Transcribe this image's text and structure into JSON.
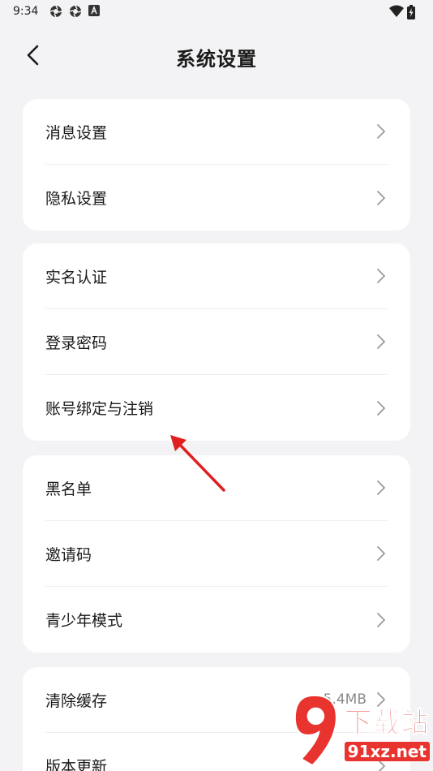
{
  "status_bar": {
    "time": "9:34",
    "icons_left": [
      "aperture-icon",
      "aperture-icon",
      "accessibility-a-icon"
    ],
    "icons_right": [
      "wifi-icon",
      "battery-charging-icon"
    ]
  },
  "header": {
    "back_icon": "chevron-left-icon",
    "title": "系统设置"
  },
  "groups": [
    {
      "items": [
        {
          "label": "消息设置"
        },
        {
          "label": "隐私设置"
        }
      ]
    },
    {
      "items": [
        {
          "label": "实名认证"
        },
        {
          "label": "登录密码"
        },
        {
          "label": "账号绑定与注销"
        }
      ]
    },
    {
      "items": [
        {
          "label": "黑名单"
        },
        {
          "label": "邀请码"
        },
        {
          "label": "青少年模式"
        }
      ]
    },
    {
      "items": [
        {
          "label": "清除缓存",
          "value": "5.4MB"
        },
        {
          "label": "版本更新"
        }
      ]
    }
  ],
  "annotation": {
    "arrow_color": "#e02020"
  },
  "watermark": {
    "title": "下载站",
    "url": "91xz.net",
    "color": "#e8332f"
  },
  "colors": {
    "background": "#f3f3f5",
    "card": "#ffffff",
    "text": "#1a1a1a",
    "secondary_text": "#8a8a8a",
    "chevron": "#9a9a9a"
  }
}
